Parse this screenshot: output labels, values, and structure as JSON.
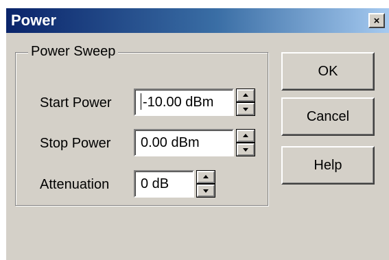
{
  "window": {
    "title": "Power",
    "close_glyph": "×",
    "titlebar_colors": [
      "#0a246a",
      "#a6caf0"
    ],
    "background": "#d4d0c8"
  },
  "power_sweep": {
    "group_label": "Power Sweep",
    "start_power": {
      "label": "Start Power",
      "value": "-10.00 dBm"
    },
    "stop_power": {
      "label": "Stop Power",
      "value": "0.00 dBm"
    },
    "attenuation": {
      "label": "Attenuation",
      "value": "0 dB"
    }
  },
  "buttons": {
    "ok": "OK",
    "cancel": "Cancel",
    "help": "Help"
  },
  "icons": {
    "close": "close-icon",
    "spin_up": "spin-up-arrow-icon",
    "spin_down": "spin-down-arrow-icon"
  }
}
